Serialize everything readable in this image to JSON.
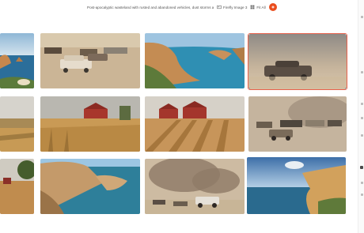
{
  "toolbar": {
    "prompt": "Post-apocalyptic wasteland with rusted and abandoned vehicles, dust storms an",
    "model_label": "Firefly Image 3",
    "variation_label": "Fit All",
    "model_icon": "image-icon",
    "fit_icon": "grid-icon",
    "generate_icon": "sparkle-icon"
  },
  "colors": {
    "accent": "#ea4d1e",
    "selection": "#e8624c"
  },
  "images": [
    {
      "id": "coast-1",
      "subject": "coastal cliffs"
    },
    {
      "id": "wasteland-1",
      "subject": "abandoned cars in desert"
    },
    {
      "id": "coast-2",
      "subject": "bay with cliffs"
    },
    {
      "id": "wasteland-2",
      "subject": "dusty car wreck"
    },
    {
      "id": "farm-1",
      "subject": "farmland"
    },
    {
      "id": "farm-2",
      "subject": "red barn wheat field"
    },
    {
      "id": "farm-3",
      "subject": "two red barns"
    },
    {
      "id": "wasteland-3",
      "subject": "dust storm vehicles"
    },
    {
      "id": "farm-4",
      "subject": "farmland with tree"
    },
    {
      "id": "coast-3",
      "subject": "rocky coast"
    },
    {
      "id": "wasteland-4",
      "subject": "dust storm trucks"
    },
    {
      "id": "coast-4",
      "subject": "cliff sunset"
    }
  ]
}
